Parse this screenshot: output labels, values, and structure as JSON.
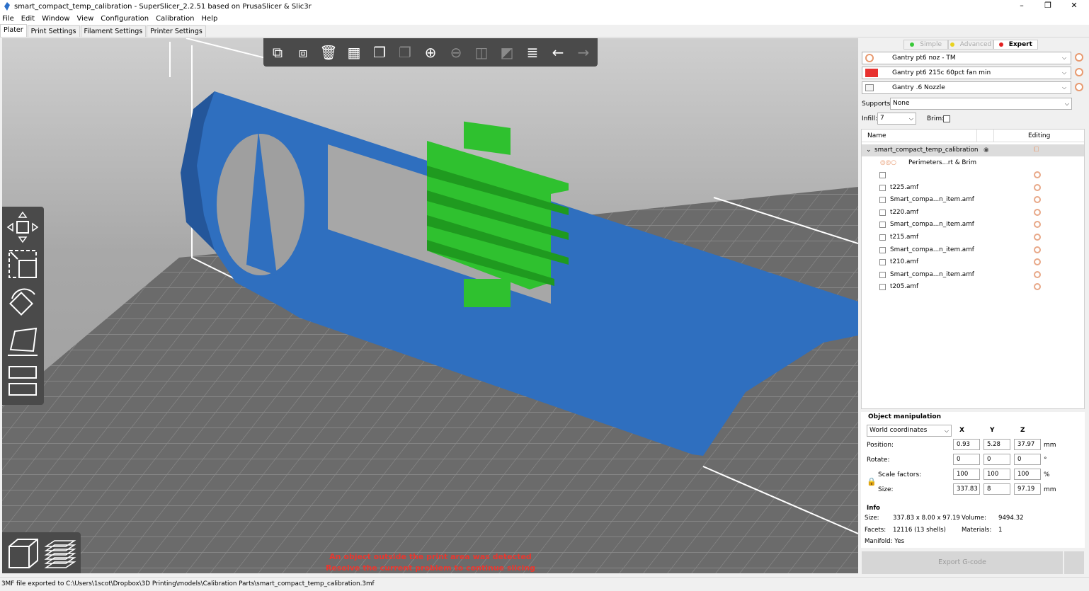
{
  "window": {
    "title": "smart_compact_temp_calibration - SuperSlicer_2.2.51 based on PrusaSlicer & Slic3r",
    "minimize": "–",
    "maximize": "❐",
    "close": "✕"
  },
  "menu": [
    "File",
    "Edit",
    "Window",
    "View",
    "Configuration",
    "Calibration",
    "Help"
  ],
  "tabs": [
    "Plater",
    "Print Settings",
    "Filament Settings",
    "Printer Settings"
  ],
  "viewport": {
    "warning_line1": "An object outside the print area was detected",
    "warning_line2": "Resolve the current problem to continue slicing"
  },
  "modes": {
    "simple": "Simple",
    "advanced": "Advanced",
    "expert": "Expert"
  },
  "presets": {
    "print": "Gantry pt6 noz - TM",
    "filament": "Gantry pt6 215c 60pct fan min",
    "printer": "Gantry .6 Nozzle",
    "filament_color": "#e8312f"
  },
  "supports": {
    "label": "Supports:",
    "value": "None"
  },
  "infill": {
    "label": "Infill:",
    "value": "7"
  },
  "brim": {
    "label": "Brim:"
  },
  "objects": {
    "col_name": "Name",
    "col_editing": "Editing",
    "root": "smart_compact_temp_calibration",
    "settings": "Perimeters...rt & Brim",
    "items": [
      "t225.amf",
      "Smart_compa...n_item.amf",
      "t220.amf",
      "Smart_compa...n_item.amf",
      "t215.amf",
      "Smart_compa...n_item.amf",
      "t210.amf",
      "Smart_compa...n_item.amf",
      "t205.amf"
    ]
  },
  "manipulation": {
    "title": "Object manipulation",
    "coord": "World coordinates",
    "x": "X",
    "y": "Y",
    "z": "Z",
    "position_label": "Position:",
    "position": [
      "0.93",
      "5.28",
      "37.97"
    ],
    "position_unit": "mm",
    "rotate_label": "Rotate:",
    "rotate": [
      "0",
      "0",
      "0"
    ],
    "rotate_unit": "°",
    "scale_label": "Scale factors:",
    "scale": [
      "100",
      "100",
      "100"
    ],
    "scale_unit": "%",
    "size_label": "Size:",
    "size": [
      "337.83",
      "8",
      "97.19"
    ],
    "size_unit": "mm"
  },
  "info": {
    "title": "Info",
    "size_label": "Size:",
    "size": "337.83 x 8.00 x 97.19",
    "volume_label": "Volume:",
    "volume": "9494.32",
    "facets_label": "Facets:",
    "facets": "12116 (13 shells)",
    "materials_label": "Materials:",
    "materials": "1",
    "manifold": "Manifold: Yes"
  },
  "export_button": "Export G-code",
  "status": "3MF file exported to C:\\Users\\1scot\\Dropbox\\3D Printing\\models\\Calibration Parts\\smart_compact_temp_calibration.3mf",
  "colors": {
    "model_blue": "#2f6fbf",
    "model_green": "#2fc12f",
    "toolbar": "#4a4a4a",
    "warning": "#e8372f"
  }
}
